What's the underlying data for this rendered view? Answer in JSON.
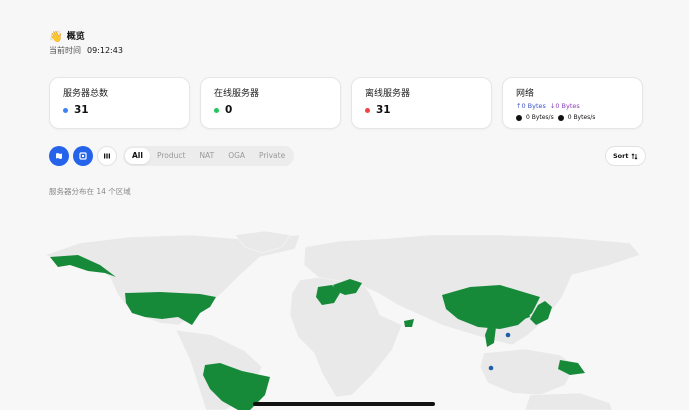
{
  "header": {
    "emoji": "👋",
    "title": "概览",
    "time_label": "当前时间",
    "time_value": "09:12:43"
  },
  "cards": {
    "total": {
      "label": "服务器总数",
      "value": "31",
      "color": "#3b82f6"
    },
    "online": {
      "label": "在线服务器",
      "value": "0",
      "color": "#22c55e"
    },
    "offline": {
      "label": "离线服务器",
      "value": "31",
      "color": "#ef4444"
    },
    "network": {
      "label": "网络",
      "up_total": "↑0 Bytes",
      "down_total": "↓0 Bytes",
      "up_speed": "0 Bytes/s",
      "down_speed": "0 Bytes/s"
    }
  },
  "toolbar": {
    "tabs": [
      "All",
      "Product",
      "NAT",
      "OGA",
      "Private"
    ],
    "active_tab": "All",
    "sort_label": "Sort",
    "accent": "#2563eb"
  },
  "region_text": "服务器分布在 14 个区域",
  "map": {
    "highlight_color": "#178a3a",
    "base_color": "#e9e9e9",
    "marker_color": "#1f5fa8",
    "highlighted_regions": [
      "Alaska",
      "United States",
      "Brazil",
      "France",
      "Germany",
      "China",
      "Japan",
      "Korea",
      "Vietnam",
      "UAE",
      "Papua New Guinea"
    ]
  }
}
